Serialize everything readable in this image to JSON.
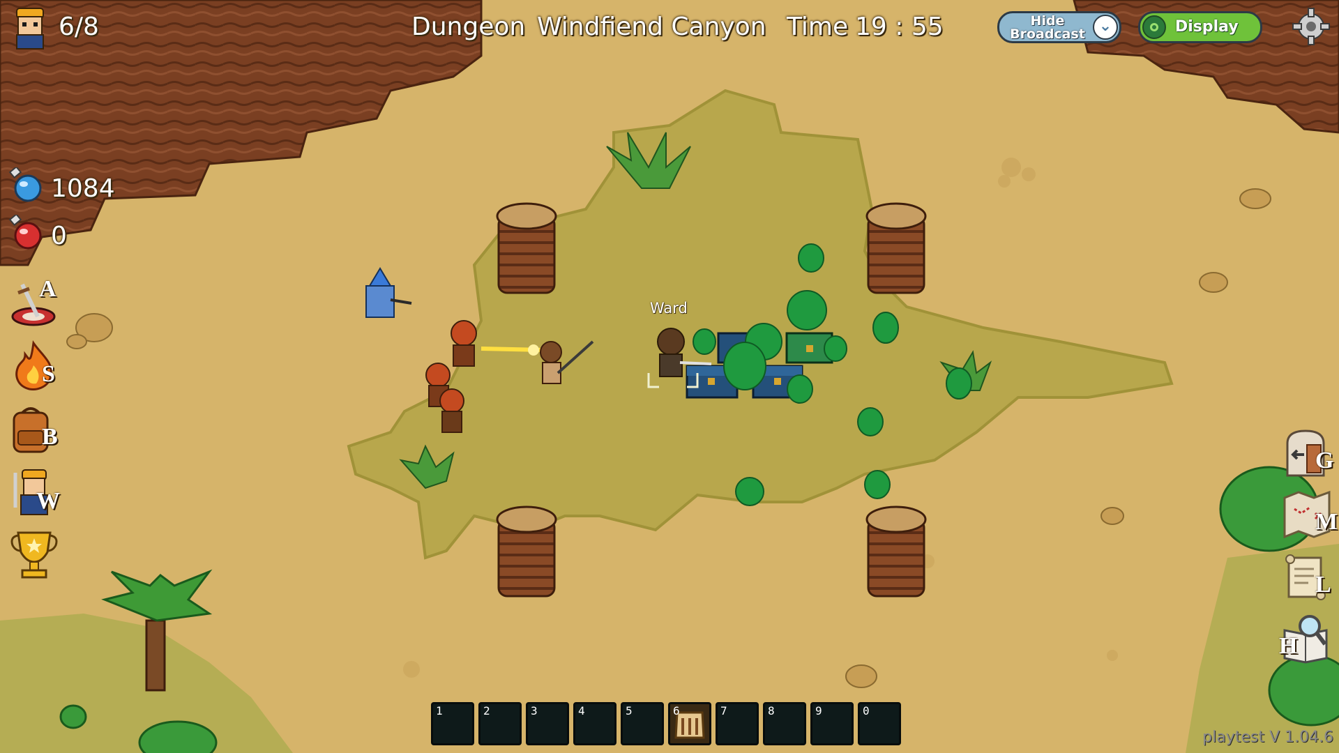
{
  "hud": {
    "party_count": "6/8",
    "dungeon_label": "Dungeon",
    "dungeon_name": "Windfiend Canyon",
    "time_label": "Time",
    "time_value": "19 : 55",
    "hide_broadcast_label": "Hide Broadcast",
    "display_label": "Display",
    "blue_potion_count": "1084",
    "red_potion_count": "0",
    "version": "playtest V 1.04.6"
  },
  "left_menu": [
    {
      "key": "A",
      "icon": "sword-target-icon"
    },
    {
      "key": "S",
      "icon": "fire-skill-icon"
    },
    {
      "key": "B",
      "icon": "backpack-icon"
    },
    {
      "key": "W",
      "icon": "hero-icon"
    },
    {
      "key": "",
      "icon": "trophy-icon"
    }
  ],
  "right_menu": [
    {
      "key": "G",
      "icon": "exit-door-icon"
    },
    {
      "key": "M",
      "icon": "map-icon"
    },
    {
      "key": "L",
      "icon": "scroll-icon"
    },
    {
      "key": "H",
      "icon": "magnifier-book-icon"
    }
  ],
  "hotbar": [
    "1",
    "2",
    "3",
    "4",
    "5",
    "6",
    "7",
    "8",
    "9",
    "0"
  ],
  "nameplate": "Ward",
  "colors": {
    "sand": "#d6b46a",
    "grass": "#b4a64a",
    "cliff": "#7a3f22",
    "display_green": "#6fc23a",
    "hide_blue": "#8fb8cf"
  }
}
